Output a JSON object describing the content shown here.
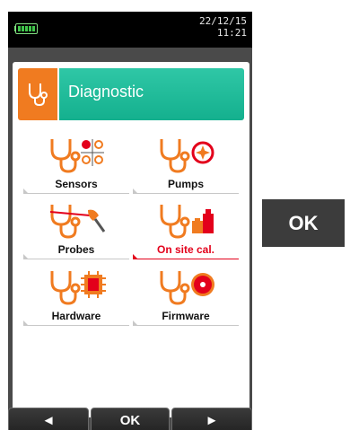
{
  "status": {
    "battery_icon": "battery-full-icon",
    "date": "22/12/15",
    "time": "11:21"
  },
  "header": {
    "icon": "stethoscope-icon",
    "title": "Diagnostic"
  },
  "tiles": [
    {
      "label": "Sensors",
      "icon": "sensors-icon",
      "selected": false
    },
    {
      "label": "Pumps",
      "icon": "pumps-icon",
      "selected": false
    },
    {
      "label": "Probes",
      "icon": "probes-icon",
      "selected": false
    },
    {
      "label": "On site cal.",
      "icon": "on-site-calibration-icon",
      "selected": true
    },
    {
      "label": "Hardware",
      "icon": "hardware-icon",
      "selected": false
    },
    {
      "label": "Firmware",
      "icon": "firmware-icon",
      "selected": false
    }
  ],
  "softkeys": {
    "left": "◄",
    "center": "OK",
    "right": "►"
  },
  "side_button": {
    "label": "OK"
  },
  "colors": {
    "accent_orange": "#f07b20",
    "header_teal": "#1fb99a",
    "selected_red": "#e3001b"
  }
}
